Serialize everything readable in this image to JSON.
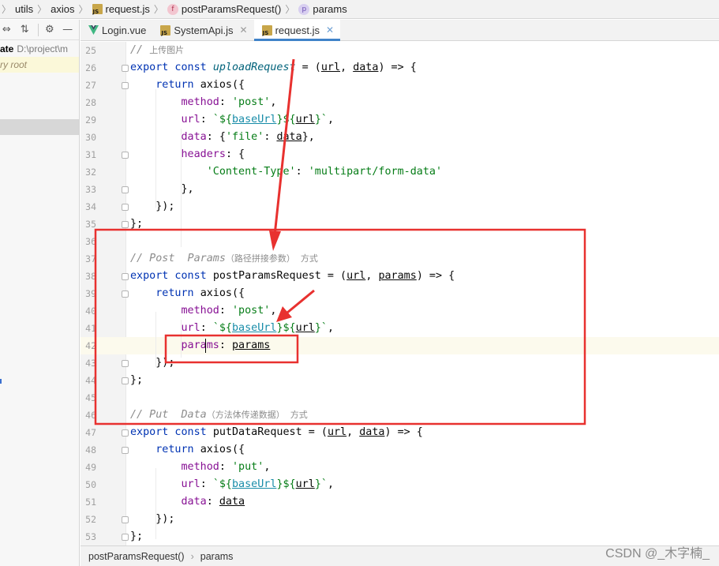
{
  "breadcrumb": {
    "items": [
      {
        "label": "utils"
      },
      {
        "label": "axios"
      },
      {
        "label": "request.js",
        "icon": "js-file-icon"
      },
      {
        "label": "postParamsRequest()",
        "icon": "function-icon"
      },
      {
        "label": "params",
        "icon": "property-icon"
      }
    ]
  },
  "project_panel": {
    "project_name_fragment": "ate",
    "project_path": "D:\\project\\m",
    "library_root_label": "ry root"
  },
  "tabs": [
    {
      "label": "Login.vue",
      "icon": "vue-file-icon",
      "active": false
    },
    {
      "label": "SystemApi.js",
      "icon": "js-file-icon",
      "active": false
    },
    {
      "label": "request.js",
      "icon": "js-file-icon",
      "active": true
    }
  ],
  "editor": {
    "lines": [
      {
        "n": "25",
        "tokens": [
          [
            "cm",
            "// "
          ],
          [
            "cmz",
            "上传图片"
          ]
        ]
      },
      {
        "n": "26",
        "tokens": [
          [
            "kw",
            "export const "
          ],
          [
            "fnd",
            "uploadRequest"
          ],
          [
            "",
            " = ("
          ],
          [
            "var",
            "url"
          ],
          [
            "",
            ", "
          ],
          [
            "var",
            "data"
          ],
          [
            "",
            ") => {"
          ]
        ]
      },
      {
        "n": "27",
        "tokens": [
          [
            "",
            "    "
          ],
          [
            "kw",
            "return "
          ],
          [
            "",
            "axios({"
          ]
        ]
      },
      {
        "n": "28",
        "tokens": [
          [
            "",
            "        "
          ],
          [
            "prop",
            "method"
          ],
          [
            "",
            ": "
          ],
          [
            "str",
            "'post'"
          ],
          [
            "",
            ","
          ]
        ]
      },
      {
        "n": "29",
        "tokens": [
          [
            "",
            "        "
          ],
          [
            "prop",
            "url"
          ],
          [
            "",
            ": "
          ],
          [
            "tpl",
            "`${"
          ],
          [
            "gvar",
            "baseUrl"
          ],
          [
            "tpl",
            "}${"
          ],
          [
            "var",
            "url"
          ],
          [
            "tpl",
            "}`"
          ],
          [
            "",
            ","
          ]
        ]
      },
      {
        "n": "30",
        "tokens": [
          [
            "",
            "        "
          ],
          [
            "prop",
            "data"
          ],
          [
            "",
            ": {"
          ],
          [
            "str",
            "'file'"
          ],
          [
            "",
            ": "
          ],
          [
            "var",
            "data"
          ],
          [
            "",
            "},"
          ]
        ]
      },
      {
        "n": "31",
        "tokens": [
          [
            "",
            "        "
          ],
          [
            "prop",
            "headers"
          ],
          [
            "",
            ": {"
          ]
        ]
      },
      {
        "n": "32",
        "tokens": [
          [
            "",
            "            "
          ],
          [
            "str",
            "'Content-Type'"
          ],
          [
            "",
            ": "
          ],
          [
            "str",
            "'multipart/form-data'"
          ]
        ]
      },
      {
        "n": "33",
        "tokens": [
          [
            "",
            "        },"
          ]
        ]
      },
      {
        "n": "34",
        "tokens": [
          [
            "",
            "    });"
          ]
        ]
      },
      {
        "n": "35",
        "tokens": [
          [
            "",
            "};"
          ]
        ]
      },
      {
        "n": "36",
        "tokens": []
      },
      {
        "n": "37",
        "tokens": [
          [
            "cm",
            "// Post  Params"
          ],
          [
            "cmz",
            "（路径拼接参数）  方式"
          ]
        ]
      },
      {
        "n": "38",
        "tokens": [
          [
            "kw",
            "export const "
          ],
          [
            "",
            "postParamsRequest = ("
          ],
          [
            "var",
            "url"
          ],
          [
            "",
            ", "
          ],
          [
            "var",
            "params"
          ],
          [
            "",
            ") => {"
          ]
        ]
      },
      {
        "n": "39",
        "tokens": [
          [
            "",
            "    "
          ],
          [
            "kw",
            "return "
          ],
          [
            "",
            "axios({"
          ]
        ]
      },
      {
        "n": "40",
        "tokens": [
          [
            "",
            "        "
          ],
          [
            "prop",
            "method"
          ],
          [
            "",
            ": "
          ],
          [
            "str",
            "'post'"
          ],
          [
            "",
            ","
          ]
        ]
      },
      {
        "n": "41",
        "tokens": [
          [
            "",
            "        "
          ],
          [
            "prop",
            "url"
          ],
          [
            "",
            ": "
          ],
          [
            "tpl",
            "`${"
          ],
          [
            "gvar",
            "baseUrl"
          ],
          [
            "tpl",
            "}${"
          ],
          [
            "var",
            "url"
          ],
          [
            "tpl",
            "}`"
          ],
          [
            "",
            ","
          ]
        ]
      },
      {
        "n": "42",
        "tokens": [
          [
            "",
            "        "
          ],
          [
            "prop",
            "params"
          ],
          [
            "",
            ": "
          ],
          [
            "var",
            "params"
          ]
        ],
        "current": true
      },
      {
        "n": "43",
        "tokens": [
          [
            "",
            "    });"
          ]
        ]
      },
      {
        "n": "44",
        "tokens": [
          [
            "",
            "};"
          ]
        ]
      },
      {
        "n": "45",
        "tokens": []
      },
      {
        "n": "46",
        "tokens": [
          [
            "cm",
            "// Put  Data"
          ],
          [
            "cmz",
            "（方法体传递数据）  方式"
          ]
        ]
      },
      {
        "n": "47",
        "tokens": [
          [
            "kw",
            "export const "
          ],
          [
            "",
            "putDataRequest = ("
          ],
          [
            "var",
            "url"
          ],
          [
            "",
            ", "
          ],
          [
            "var",
            "data"
          ],
          [
            "",
            ") => {"
          ]
        ]
      },
      {
        "n": "48",
        "tokens": [
          [
            "",
            "    "
          ],
          [
            "kw",
            "return "
          ],
          [
            "",
            "axios({"
          ]
        ]
      },
      {
        "n": "49",
        "tokens": [
          [
            "",
            "        "
          ],
          [
            "prop",
            "method"
          ],
          [
            "",
            ": "
          ],
          [
            "str",
            "'put'"
          ],
          [
            "",
            ","
          ]
        ]
      },
      {
        "n": "50",
        "tokens": [
          [
            "",
            "        "
          ],
          [
            "prop",
            "url"
          ],
          [
            "",
            ": "
          ],
          [
            "tpl",
            "`${"
          ],
          [
            "gvar",
            "baseUrl"
          ],
          [
            "tpl",
            "}${"
          ],
          [
            "var",
            "url"
          ],
          [
            "tpl",
            "}`"
          ],
          [
            "",
            ","
          ]
        ]
      },
      {
        "n": "51",
        "tokens": [
          [
            "",
            "        "
          ],
          [
            "prop",
            "data"
          ],
          [
            "",
            ": "
          ],
          [
            "var",
            "data"
          ]
        ]
      },
      {
        "n": "52",
        "tokens": [
          [
            "",
            "    });"
          ]
        ]
      },
      {
        "n": "53",
        "tokens": [
          [
            "",
            "};"
          ]
        ]
      }
    ]
  },
  "status_bar": {
    "items": [
      "postParamsRequest()",
      "params"
    ]
  },
  "watermark": "CSDN @_木字楠_",
  "colors": {
    "annotation": "#e8312f",
    "keyword": "#0033b3",
    "string": "#067d17",
    "property": "#871094",
    "comment": "#8c8c8c",
    "active_tab_underline": "#4083c9"
  }
}
